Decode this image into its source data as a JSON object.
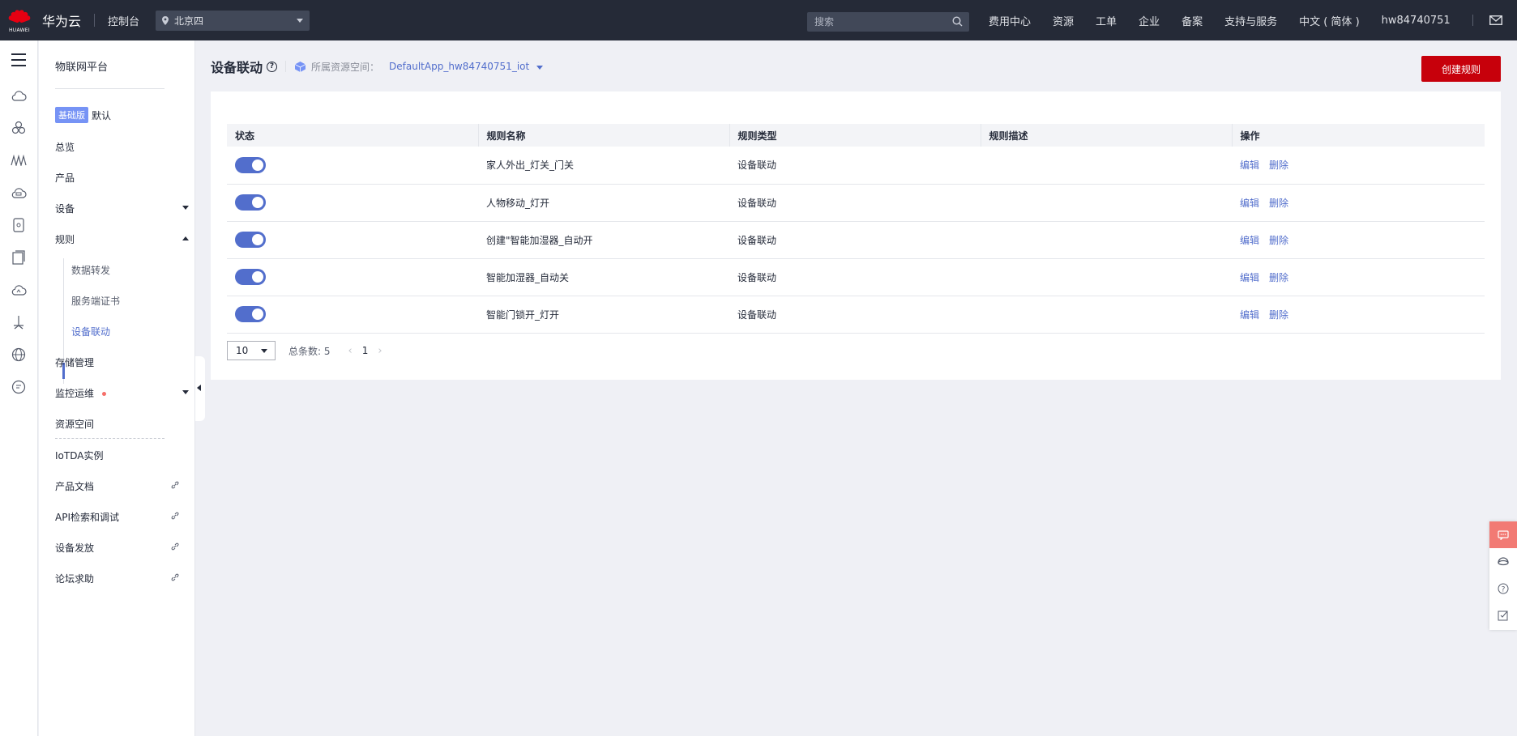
{
  "topbar": {
    "logo_small": "HUAWEI",
    "brand": "华为云",
    "console": "控制台",
    "region": "北京四",
    "search_placeholder": "搜索",
    "nav": [
      "费用中心",
      "资源",
      "工单",
      "企业",
      "备案",
      "支持与服务",
      "中文 ( 简体 )",
      "hw84740751"
    ]
  },
  "sidebar": {
    "title": "物联网平台",
    "edition_badge": "基础版",
    "edition_name": "默认",
    "items": {
      "overview": "总览",
      "product": "产品",
      "device": "设备",
      "rules": "规则",
      "data_forward": "数据转发",
      "server_cert": "服务端证书",
      "device_linkage": "设备联动",
      "storage": "存储管理",
      "monitoring": "监控运维",
      "resource_space": "资源空间",
      "iotda_instance": "IoTDA实例",
      "product_docs": "产品文档",
      "api_explorer": "API检索和调试",
      "device_provisioning": "设备发放",
      "forum": "论坛求助"
    }
  },
  "main": {
    "title": "设备联动",
    "resource_space_label": "所属资源空间：",
    "resource_space_value": "DefaultApp_hw84740751_iot",
    "create_button": "创建规则",
    "columns": [
      "状态",
      "规则名称",
      "规则类型",
      "规则描述",
      "操作"
    ],
    "rows": [
      {
        "name": "家人外出_灯关_门关",
        "type": "设备联动",
        "desc": "",
        "enabled": true
      },
      {
        "name": "人物移动_灯开",
        "type": "设备联动",
        "desc": "",
        "enabled": true
      },
      {
        "name": "创建\"智能加湿器_自动开",
        "type": "设备联动",
        "desc": "",
        "enabled": true
      },
      {
        "name": "智能加湿器_自动关",
        "type": "设备联动",
        "desc": "",
        "enabled": true
      },
      {
        "name": "智能门锁开_灯开",
        "type": "设备联动",
        "desc": "",
        "enabled": true
      }
    ],
    "op_edit": "编辑",
    "op_delete": "删除",
    "pager": {
      "page_size": "10",
      "total": "总条数: 5",
      "current_page": "1"
    }
  },
  "colors": {
    "topbar_bg": "#252a37",
    "accent": "#526ecc",
    "create_button": "#c7000b",
    "badge": "#7693f5"
  }
}
